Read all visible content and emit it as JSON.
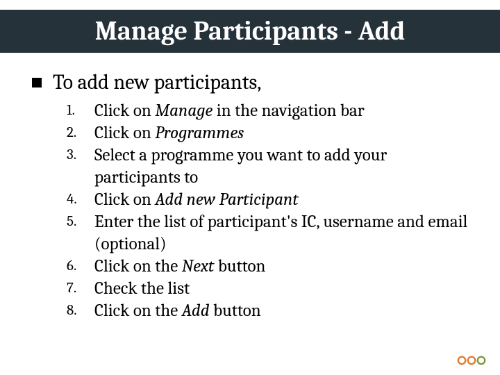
{
  "title": "Manage Participants - Add",
  "lead": "To add new participants,",
  "steps": [
    [
      {
        "t": "Click on ",
        "i": false
      },
      {
        "t": "Manage",
        "i": true
      },
      {
        "t": " in the navigation bar",
        "i": false
      }
    ],
    [
      {
        "t": "Click on ",
        "i": false
      },
      {
        "t": "Programmes",
        "i": true
      }
    ],
    [
      {
        "t": "Select a programme you want to add your participants to",
        "i": false
      }
    ],
    [
      {
        "t": "Click on ",
        "i": false
      },
      {
        "t": "Add new Participant",
        "i": true
      }
    ],
    [
      {
        "t": "Enter the list of participant's IC, username and email (optional)",
        "i": false
      }
    ],
    [
      {
        "t": "Click on the ",
        "i": false
      },
      {
        "t": "Next",
        "i": true
      },
      {
        "t": " button",
        "i": false
      }
    ],
    [
      {
        "t": "Check the list",
        "i": false
      }
    ],
    [
      {
        "t": "Click on the ",
        "i": false
      },
      {
        "t": "Add",
        "i": true
      },
      {
        "t": " button",
        "i": false
      }
    ]
  ],
  "dots": {
    "colors": [
      "#e07b2e",
      "#e07b2e",
      "#7a9a3b"
    ]
  }
}
